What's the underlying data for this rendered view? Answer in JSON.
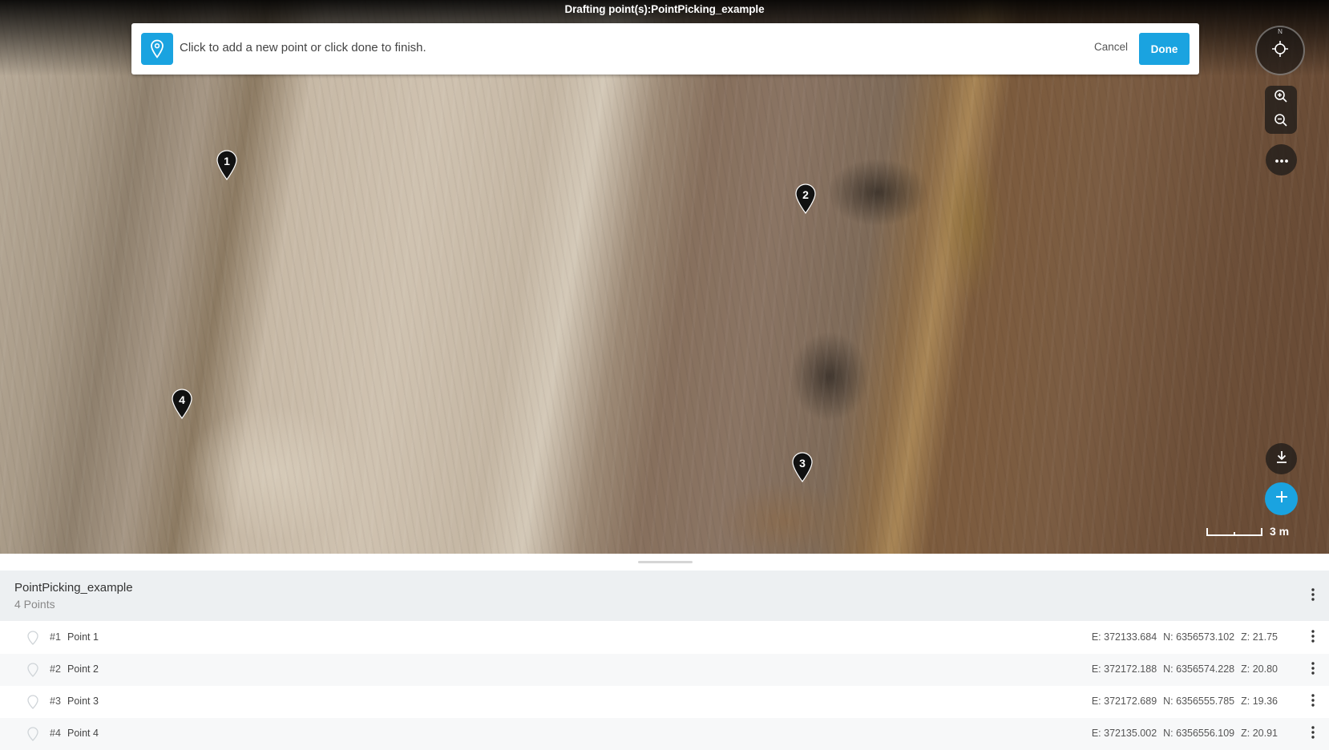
{
  "window_title": "Drafting point(s):PointPicking_example",
  "prompt": {
    "text": "Click to add a new point or click done to finish.",
    "cancel_label": "Cancel",
    "done_label": "Done"
  },
  "map_controls": {
    "compass_label": "N",
    "scale_label": "3 m",
    "icons": [
      "compass-icon",
      "zoom-in-icon",
      "zoom-out-icon",
      "more-icon",
      "download-icon",
      "add-icon"
    ]
  },
  "markers": [
    {
      "label": "1"
    },
    {
      "label": "2"
    },
    {
      "label": "3"
    },
    {
      "label": "4"
    }
  ],
  "layer": {
    "name": "PointPicking_example",
    "count": "4 Points",
    "points": [
      {
        "num": "#1",
        "name": "Point 1",
        "e": "E: 372133.684",
        "n": "N: 6356573.102",
        "z": "Z: 21.75"
      },
      {
        "num": "#2",
        "name": "Point 2",
        "e": "E: 372172.188",
        "n": "N: 6356574.228",
        "z": "Z: 20.80"
      },
      {
        "num": "#3",
        "name": "Point 3",
        "e": "E: 372172.689",
        "n": "N: 6356555.785",
        "z": "Z: 19.36"
      },
      {
        "num": "#4",
        "name": "Point 4",
        "e": "E: 372135.002",
        "n": "N: 6356556.109",
        "z": "Z: 20.91"
      }
    ]
  },
  "colors": {
    "accent": "#1aa3e0",
    "marker": "#111111",
    "header_bg": "#edf0f2"
  }
}
